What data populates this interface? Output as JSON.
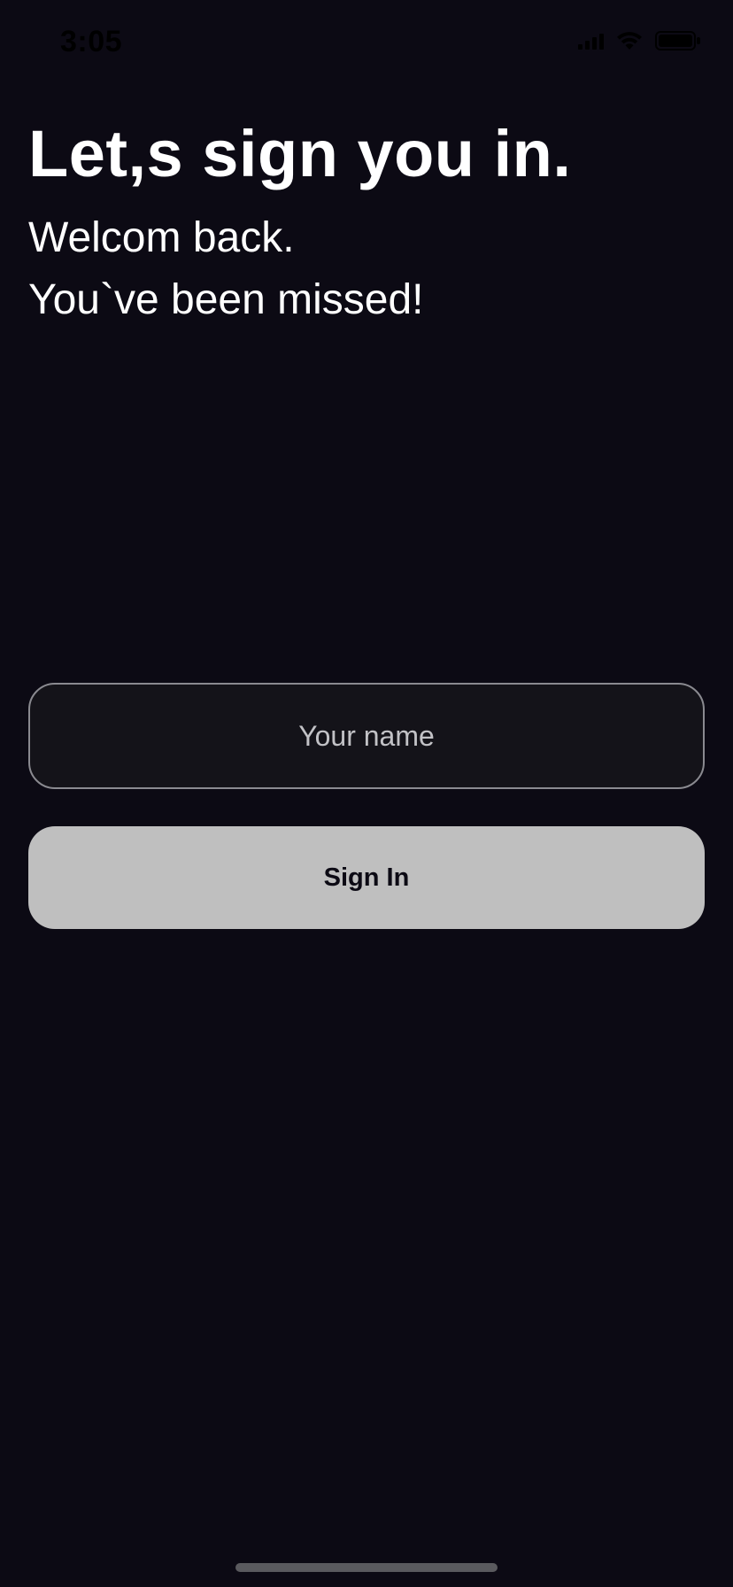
{
  "status_bar": {
    "time": "3:05"
  },
  "header": {
    "title": "Let,s sign you in.",
    "subtitle_line1": "Welcom back.",
    "subtitle_line2": "You`ve been missed!"
  },
  "form": {
    "name_placeholder": "Your name",
    "name_value": "",
    "sign_in_label": "Sign In"
  },
  "colors": {
    "background": "#0c0a14",
    "button_bg": "#bfbfbf",
    "input_border": "#8a8a90"
  },
  "icons": [
    "signal-icon",
    "wifi-icon",
    "battery-icon"
  ]
}
